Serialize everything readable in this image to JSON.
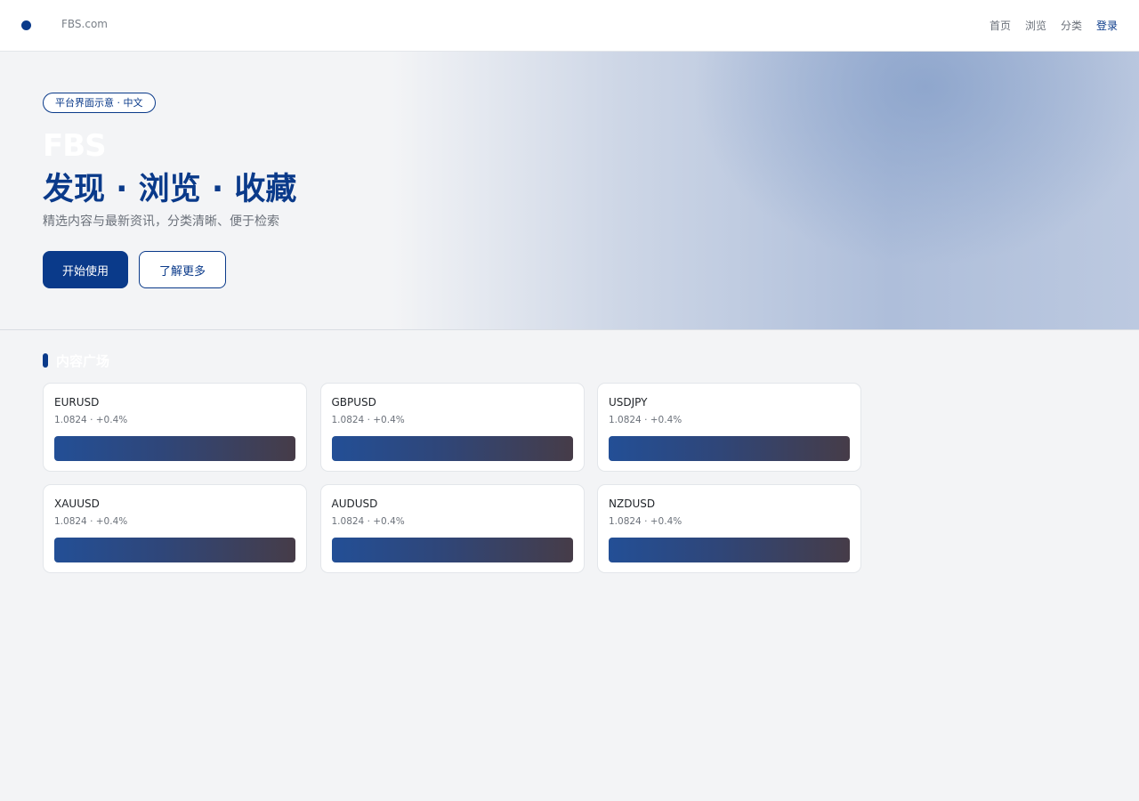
{
  "header": {
    "brand": "FBS.com",
    "nav": [
      "首页",
      "浏览",
      "分类"
    ],
    "login": "登录"
  },
  "hero": {
    "badge": "平台界面示意 · 中文",
    "brand": "FBS",
    "title": "发现 · 浏览 · 收藏",
    "subtitle": "精选内容与最新资讯，分类清晰、便于检索",
    "primary_button": "开始使用",
    "secondary_button": "了解更多"
  },
  "section": {
    "title": "内容广场",
    "cards": [
      {
        "symbol": "EURUSD",
        "meta": "1.0824 · +0.4%"
      },
      {
        "symbol": "GBPUSD",
        "meta": "1.0824 · +0.4%"
      },
      {
        "symbol": "USDJPY",
        "meta": "1.0824 · +0.4%"
      },
      {
        "symbol": "XAUUSD",
        "meta": "1.0824 · +0.4%"
      },
      {
        "symbol": "AUDUSD",
        "meta": "1.0824 · +0.4%"
      },
      {
        "symbol": "NZDUSD",
        "meta": "1.0824 · +0.4%"
      }
    ]
  },
  "colors": {
    "accent": "#0a3a8a",
    "background": "#f3f4f6"
  }
}
